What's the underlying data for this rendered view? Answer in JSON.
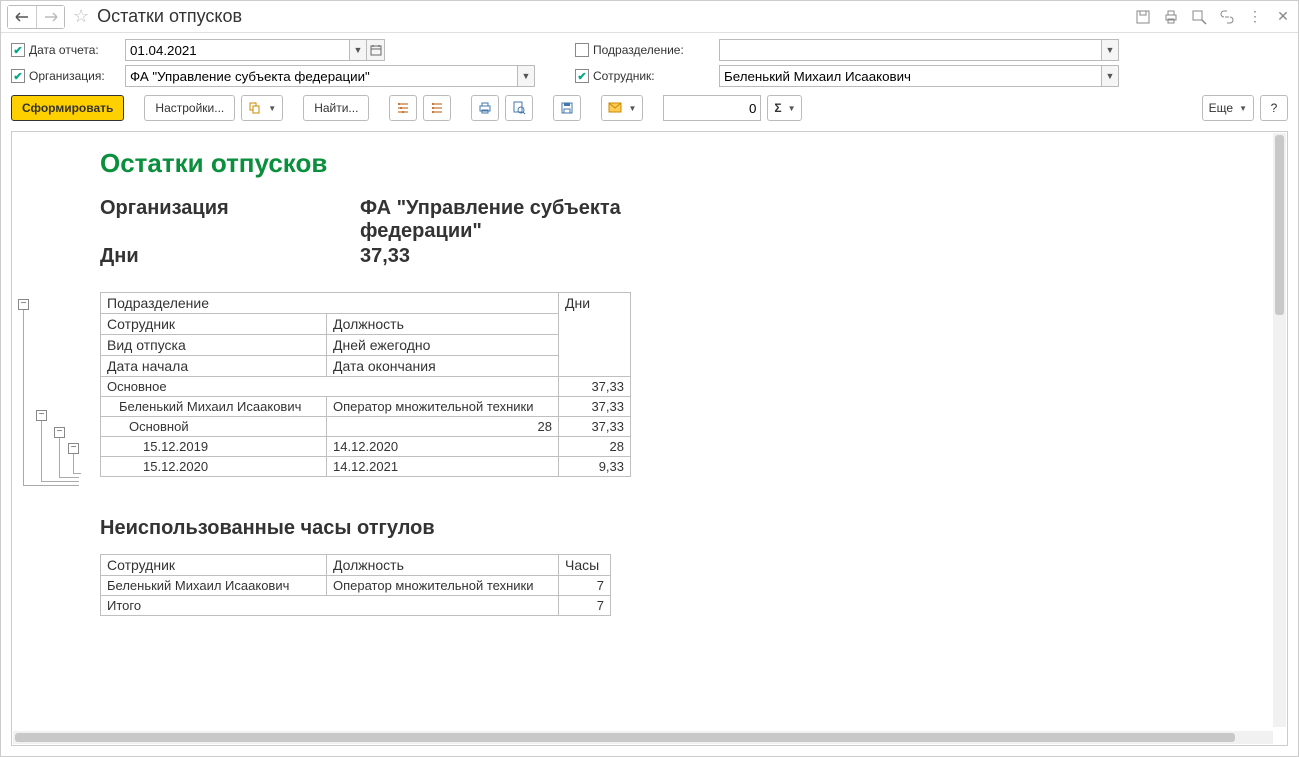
{
  "title": "Остатки отпусков",
  "params": {
    "date_label": "Дата отчета:",
    "date_value": "01.04.2021",
    "org_label": "Организация:",
    "org_value": "ФА \"Управление субъекта федерации\"",
    "dep_label": "Подразделение:",
    "dep_value": "",
    "emp_label": "Сотрудник:",
    "emp_value": "Беленький Михаил Исаакович",
    "date_checked": true,
    "org_checked": true,
    "dep_checked": false,
    "emp_checked": true
  },
  "toolbar": {
    "generate": "Сформировать",
    "settings": "Настройки...",
    "find": "Найти...",
    "num_value": "0",
    "more": "Еще",
    "help": "?"
  },
  "report": {
    "heading": "Остатки отпусков",
    "summary": [
      {
        "label": "Организация",
        "value": "ФА \"Управление субъекта федерации\""
      },
      {
        "label": "Дни",
        "value": "37,33"
      }
    ],
    "table1": {
      "headers": {
        "r1c1": "Подразделение",
        "r1c3": "Дни",
        "r2c1": "Сотрудник",
        "r2c2": "Должность",
        "r3c1": "Вид отпуска",
        "r3c2": "Дней ежегодно",
        "r4c1": "Дата начала",
        "r4c2": "Дата окончания"
      },
      "rows": [
        {
          "lvl": 0,
          "c1": "Основное",
          "c2": "",
          "c3": "37,33"
        },
        {
          "lvl": 1,
          "c1": "Беленький Михаил Исаакович",
          "c2": "Оператор множительной техники",
          "c3": "37,33"
        },
        {
          "lvl": 2,
          "c1": "Основной",
          "c2": "28",
          "c2num": true,
          "c3": "37,33"
        },
        {
          "lvl": 3,
          "c1": "15.12.2019",
          "c2": "14.12.2020",
          "c3": "28"
        },
        {
          "lvl": 3,
          "c1": "15.12.2020",
          "c2": "14.12.2021",
          "c3": "9,33"
        }
      ]
    },
    "section2_title": "Неиспользованные часы отгулов",
    "table2": {
      "headers": {
        "c1": "Сотрудник",
        "c2": "Должность",
        "c3": "Часы"
      },
      "rows": [
        {
          "c1": "Беленький Михаил Исаакович",
          "c2": "Оператор множительной техники",
          "c3": "7"
        },
        {
          "c1": "Итого",
          "c2": "",
          "c3": "7"
        }
      ]
    }
  }
}
